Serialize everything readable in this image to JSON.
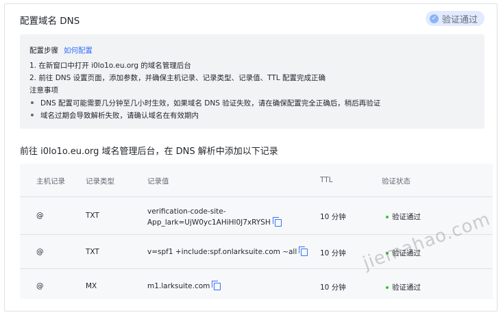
{
  "header": {
    "title": "配置域名 DNS",
    "status_badge": "验证通过"
  },
  "guide": {
    "steps_title": "配置步骤",
    "steps_link": "如何配置",
    "steps": [
      "1. 在新窗口中打开 i0lo1o.eu.org 的域名管理后台",
      "2. 前往 DNS 设置页面，添加参数，并确保主机记录、记录类型、记录值、TTL 配置完成正确"
    ],
    "notes_title": "注意事项",
    "notes": [
      "DNS 配置可能需要几分钟至几小时生效，如果域名 DNS 验证失败，请在确保配置完全正确后，稍后再验证",
      "域名过期会导致解析失败，请确认域名在有效期内"
    ]
  },
  "section_title": "前往 i0lo1o.eu.org 域名管理后台，在 DNS 解析中添加以下记录",
  "table": {
    "headers": [
      "主机记录",
      "记录类型",
      "记录值",
      "TTL",
      "验证状态"
    ],
    "rows": [
      {
        "host": "@",
        "type": "TXT",
        "value_line1": "verification-code-site-",
        "value_line2": "App_lark=UjW0yc1AHiHl0J7xRYSH",
        "ttl": "10 分钟",
        "status": "验证通过"
      },
      {
        "host": "@",
        "type": "TXT",
        "value_line1": "v=spf1 +include:spf.onlarksuite.com ~all",
        "value_line2": "",
        "ttl": "10 分钟",
        "status": "验证通过"
      },
      {
        "host": "@",
        "type": "MX",
        "value_line1": "m1.larksuite.com",
        "value_line2": "",
        "ttl": "10 分钟",
        "status": "验证通过"
      }
    ]
  },
  "watermark": "jiemahao.com",
  "colors": {
    "accent": "#3370ff",
    "success": "#34c724",
    "badge_bg": "#e1eaff"
  }
}
